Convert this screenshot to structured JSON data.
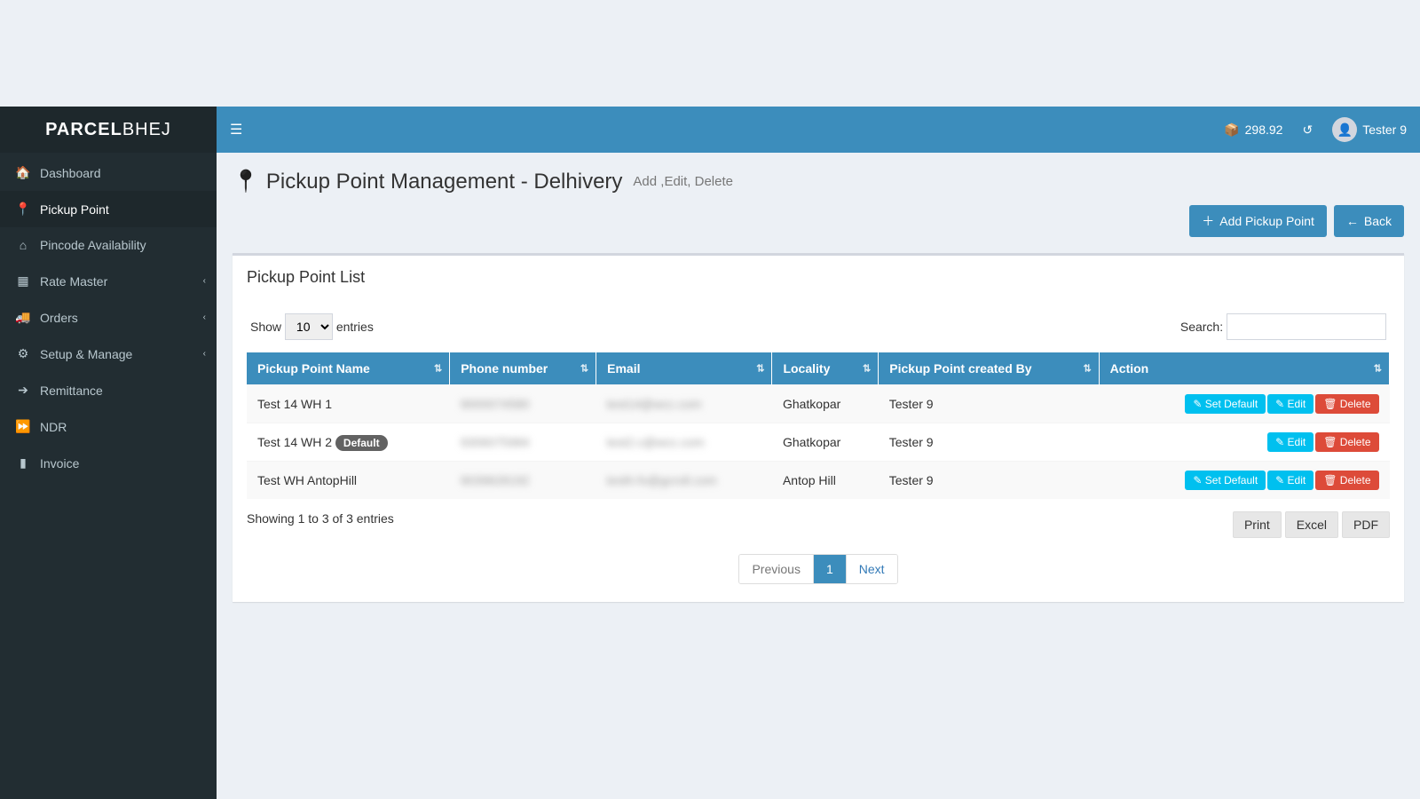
{
  "brand": {
    "prefix": "PARCEL",
    "suffix": "BHEJ"
  },
  "topbar": {
    "balance": "298.92",
    "username": "Tester 9"
  },
  "sidebar": {
    "items": [
      {
        "label": "Dashboard",
        "icon": "dashboard",
        "active": false,
        "caret": false
      },
      {
        "label": "Pickup Point",
        "icon": "pin",
        "active": true,
        "caret": false
      },
      {
        "label": "Pincode Availability",
        "icon": "home",
        "active": false,
        "caret": false
      },
      {
        "label": "Rate Master",
        "icon": "calc",
        "active": false,
        "caret": true
      },
      {
        "label": "Orders",
        "icon": "truck",
        "active": false,
        "caret": true
      },
      {
        "label": "Setup & Manage",
        "icon": "gears",
        "active": false,
        "caret": true
      },
      {
        "label": "Remittance",
        "icon": "arrow",
        "active": false,
        "caret": false
      },
      {
        "label": "NDR",
        "icon": "forward",
        "active": false,
        "caret": false
      },
      {
        "label": "Invoice",
        "icon": "file",
        "active": false,
        "caret": false
      }
    ]
  },
  "header": {
    "title": "Pickup Point Management - Delhivery",
    "subtitle": "Add ,Edit, Delete"
  },
  "buttons": {
    "add": "Add Pickup Point",
    "back": "Back",
    "set_default": "Set Default",
    "edit": "Edit",
    "delete": "Delete"
  },
  "box_title": "Pickup Point List",
  "datatable": {
    "show_prefix": "Show",
    "show_suffix": "entries",
    "page_size": "10",
    "search_label": "Search:",
    "columns": [
      "Pickup Point Name",
      "Phone number",
      "Email",
      "Locality",
      "Pickup Point created By",
      "Action"
    ],
    "rows": [
      {
        "name": "Test 14 WH 1",
        "phone": "9000074580",
        "email": "test14@wcc.com",
        "locality": "Ghatkopar",
        "created_by": "Tester 9",
        "is_default": false
      },
      {
        "name": "Test 14 WH 2",
        "phone": "9306075984",
        "email": "test2.c@wcc.com",
        "locality": "Ghatkopar",
        "created_by": "Tester 9",
        "is_default": true
      },
      {
        "name": "Test WH AntopHill",
        "phone": "9039628192",
        "email": "testh-fv@gcroll.com",
        "locality": "Antop Hill",
        "created_by": "Tester 9",
        "is_default": false
      }
    ],
    "default_badge": "Default",
    "info": "Showing 1 to 3 of 3 entries",
    "export": [
      "Print",
      "Excel",
      "PDF"
    ],
    "pagination": {
      "prev": "Previous",
      "next": "Next",
      "pages": [
        "1"
      ],
      "active": "1"
    }
  }
}
